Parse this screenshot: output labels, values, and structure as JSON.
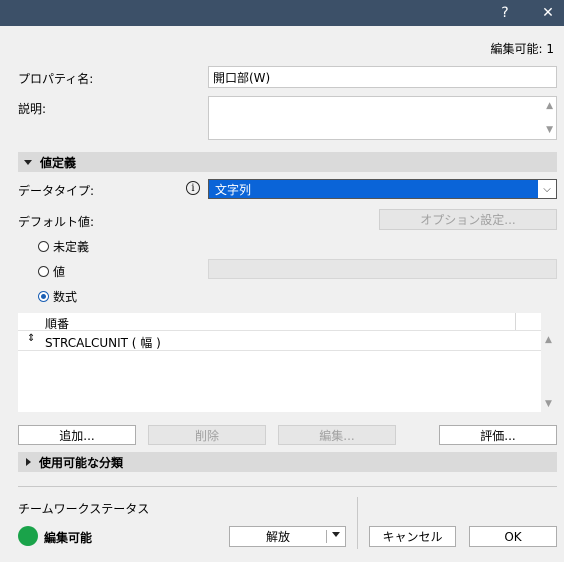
{
  "titlebar": {
    "help": "?",
    "close": "✕"
  },
  "edit_count": "編集可能: 1",
  "property_name": {
    "label": "プロパティ名:",
    "value": "開口部(W)"
  },
  "description": {
    "label": "説明:",
    "value": ""
  },
  "value_definition": {
    "section_title": "値定義",
    "data_type_label": "データタイプ:",
    "data_type_value": "文字列",
    "default_label": "デフォルト値:",
    "option_button": "オプション設定...",
    "radios": [
      {
        "label": "未定義",
        "selected": false
      },
      {
        "label": "値",
        "selected": false
      },
      {
        "label": "数式",
        "selected": true
      }
    ],
    "table_header": "順番",
    "table_rows": [
      "STRCALCUNIT ( 幅 )"
    ]
  },
  "buttons": {
    "add": "追加...",
    "delete": "削除",
    "edit": "編集...",
    "evaluate": "評価..."
  },
  "available_classes": {
    "section_title": "使用可能な分類"
  },
  "teamwork": {
    "label": "チームワークステータス",
    "status": "編集可能",
    "status_color": "#1aa34a",
    "release_button": "解放"
  },
  "footer": {
    "cancel": "キャンセル",
    "ok": "OK"
  }
}
